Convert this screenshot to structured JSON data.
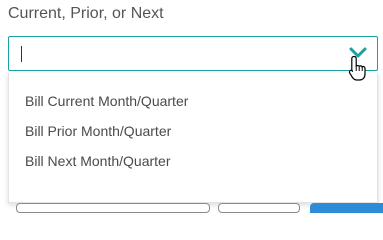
{
  "field": {
    "label": "Current, Prior, or Next",
    "value": ""
  },
  "dropdown": {
    "options": [
      "Bill Current Month/Quarter",
      "Bill Prior Month/Quarter",
      "Bill Next Month/Quarter"
    ]
  },
  "colors": {
    "accent": "#1aa1a1",
    "label_text": "#555555",
    "option_text": "#4a4a4a",
    "primary_button": "#2e8bd8"
  },
  "icons": {
    "dropdown_toggle": "chevron-down-icon",
    "pointer": "hand-cursor-icon"
  }
}
